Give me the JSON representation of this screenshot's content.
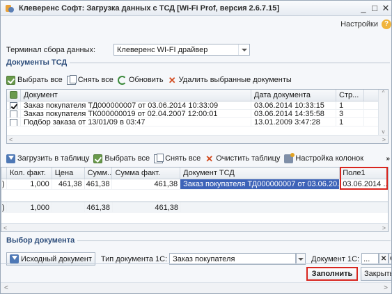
{
  "window": {
    "title": "Клеверенс Софт: Загрузка данных с ТСД [Wi-Fi Prof, версия 2.6.7.15]",
    "minimize": "_",
    "maximize": "□",
    "close": "✕"
  },
  "header": {
    "settings": "Настройки",
    "help": "?"
  },
  "terminal": {
    "label": "Терминал сбора данных:",
    "value": "Клеверенс WI-FI драйвер"
  },
  "tsd_docs": {
    "section_title": "Документы ТСД",
    "toolbar": {
      "select_all": "Выбрать все",
      "deselect_all": "Снять все",
      "refresh": "Обновить",
      "delete_selected": "Удалить выбранные документы"
    },
    "columns": [
      "Документ",
      "Дата документа",
      "Стр..."
    ],
    "rows": [
      {
        "checked": true,
        "document": "Заказ покупателя ТД000000007 от 03.06.2014 10:33:09",
        "date": "03.06.2014 10:33:15",
        "lines": "1"
      },
      {
        "checked": false,
        "document": "Заказ покупателя ТК000000019 от 02.04.2007 12:00:01",
        "date": "03.06.2014 14:35:58",
        "lines": "3"
      },
      {
        "checked": false,
        "document": "Подбор заказа от 13/01/09 в 03:47",
        "date": "13.01.2009 3:47:28",
        "lines": "1"
      }
    ]
  },
  "table": {
    "toolbar": {
      "load_to_table": "Загрузить в таблицу",
      "select_all": "Выбрать все",
      "deselect_all": "Снять все",
      "clear_table": "Очистить таблицу",
      "column_settings": "Настройка колонок",
      "more": "»"
    },
    "columns": [
      "Кол. факт.",
      "Цена",
      "Сумм...",
      "Сумма факт.",
      "Документ ТСД",
      "Поле1"
    ],
    "rows": [
      {
        "qty": "1,000",
        "price": "461,38",
        "sum": "461,38",
        "sum_fact": "461,38",
        "tsd_doc": "Заказ покупателя ТД000000007 от 03.06.20...",
        "field1": "03.06.2014 ..."
      }
    ],
    "totals": {
      "qty": "1,000",
      "sum": "461,38",
      "sum_fact": "461,38"
    }
  },
  "doc_choice": {
    "section_title": "Выбор документа",
    "source_button": "Исходный документ",
    "type_label": "Тип документа 1С:",
    "type_value": "Заказ покупателя",
    "doc_label": "Документ 1С:",
    "doc_value": "..."
  },
  "footer": {
    "fill": "Заполнить",
    "close": "Закрыть"
  },
  "scroll": {
    "left": "<",
    "right": ">",
    "up": "^",
    "down": "v"
  }
}
